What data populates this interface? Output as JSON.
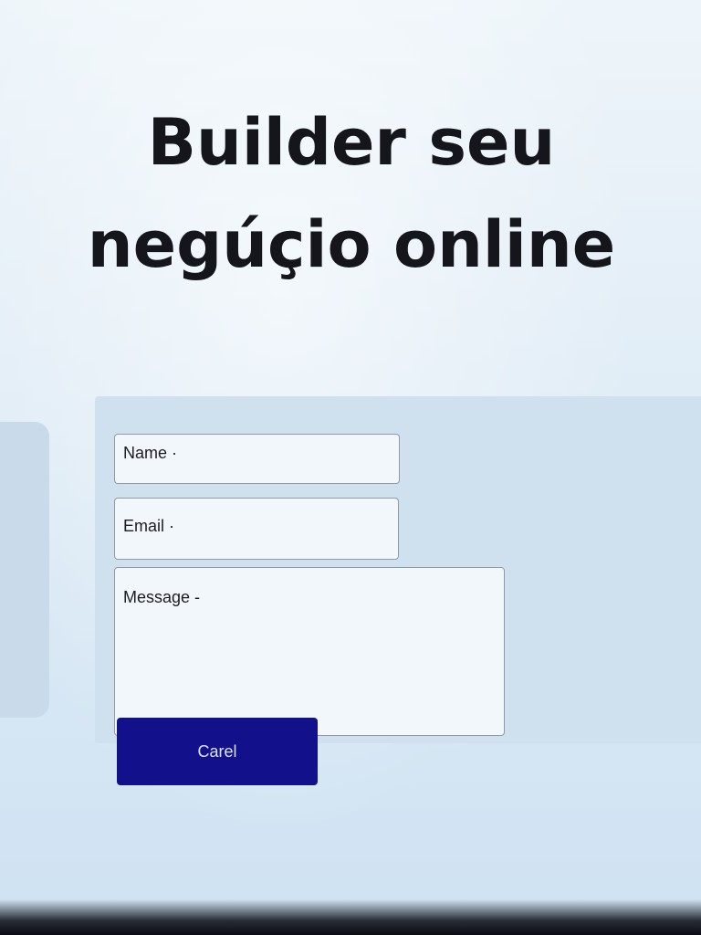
{
  "hero": {
    "line1": "Builder seu",
    "line2": "negúçio online"
  },
  "form": {
    "name_label": "Name ·",
    "email_label": "Email ·",
    "message_label": "Message -",
    "submit_label": "Carel"
  },
  "colors": {
    "background": "#e3eef7",
    "panel": "#cfe1ef",
    "button": "#12108b",
    "title": "#15161c"
  }
}
